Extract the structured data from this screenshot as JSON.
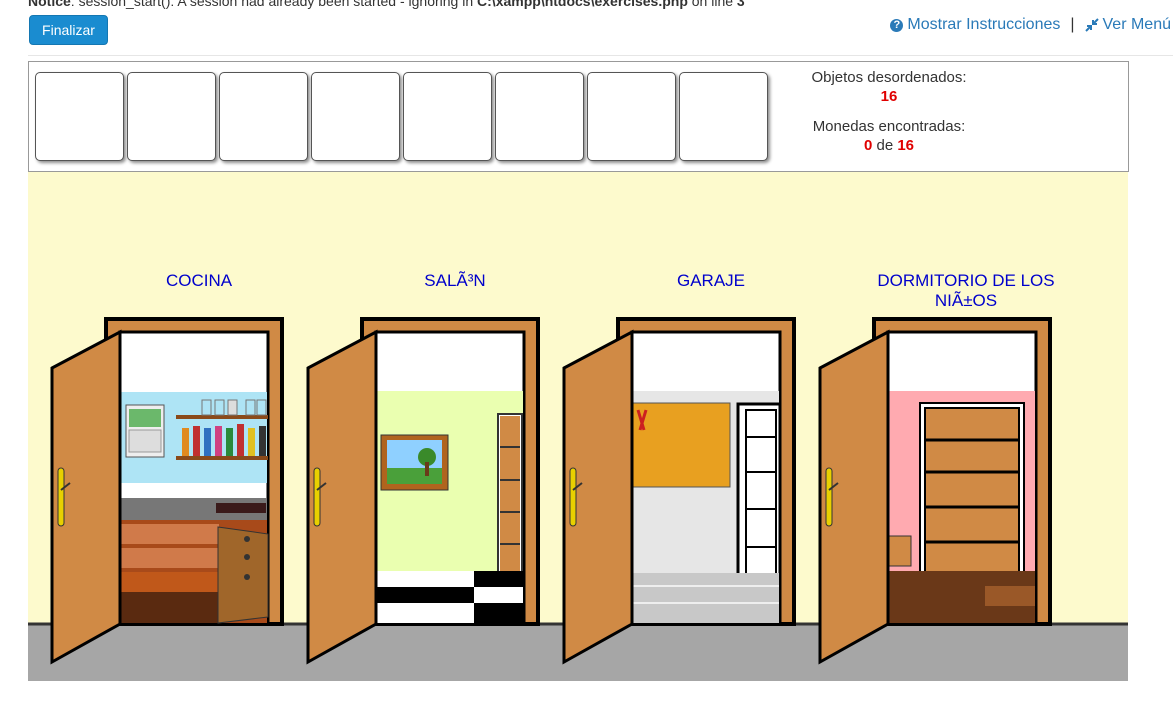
{
  "notice": {
    "label": "Notice",
    "message": ": session_start(): A session had already been started - ignoring in ",
    "path": "C:\\xampp\\htdocs\\exercises.php",
    "suffix": " on line ",
    "line": "3"
  },
  "toolbar": {
    "finalize_label": "Finalizar",
    "instructions_label": "Mostrar Instrucciones",
    "separator": "|",
    "menu_label": "Ver Menú"
  },
  "inventory": {
    "slot_count": 8
  },
  "stats": {
    "objects_label": "Objetos desordenados:",
    "objects_value": "16",
    "coins_label": "Monedas encontradas:",
    "coins_found": "0",
    "coins_of": "de",
    "coins_total": "16"
  },
  "rooms": [
    {
      "label": "COCINA"
    },
    {
      "label": "SALÃ³N"
    },
    {
      "label": "GARAJE"
    },
    {
      "label": "DORMITORIO DE LOS NIÃ±OS"
    }
  ],
  "colors": {
    "wall": "#fdfacd",
    "floor": "#a6a6a6",
    "door": "#d08a45",
    "label": "#0000cc",
    "accent_red": "#e00000",
    "button": "#1a8cd0"
  }
}
